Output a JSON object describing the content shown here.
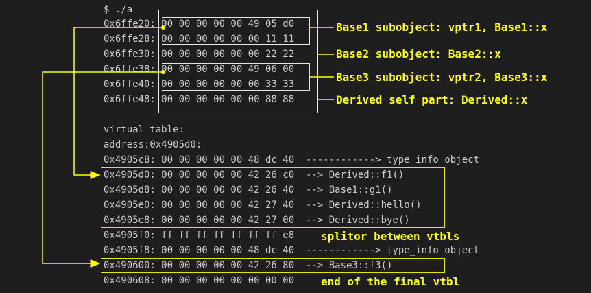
{
  "terminal": {
    "prompt": "$ ./a",
    "memory_rows": [
      "0x6ffe20: 00 00 00 00 00 49 05 d0",
      "0x6ffe28: 00 00 00 00 00 00 11 11",
      "0x6ffe30: 00 00 00 00 00 00 22 22",
      "0x6ffe38: 00 00 00 00 00 49 06 00",
      "0x6ffe40: 00 00 00 00 00 00 33 33",
      "0x6ffe48: 00 00 00 00 00 00 88 88"
    ],
    "vtable_header": "virtual table:",
    "vtable_address": "address:0x4905d0:",
    "vtable_rows": [
      "0x4905c8: 00 00 00 00 00 48 dc 40  ------------> type_info object",
      "0x4905d0: 00 00 00 00 00 42 26 c0  --> Derived::f1()",
      "0x4905d8: 00 00 00 00 00 42 26 40  --> Base1::g1()",
      "0x4905e0: 00 00 00 00 00 42 27 40  --> Derived::hello()",
      "0x4905e8: 00 00 00 00 00 42 27 00  --> Derived::bye()",
      "0x4905f0: ff ff ff ff ff ff ff e8",
      "0x4905f8: 00 00 00 00 00 48 dc 40  ------------> type_info object",
      "0x490600: 00 00 00 00 00 42 26 80  --> Base3::f3()",
      "0x490608: 00 00 00 00 00 00 00 00"
    ]
  },
  "annotations": {
    "base1": "Base1 subobject: vptr1, Base1::x",
    "base2": "Base2 subobject: Base2::x",
    "base3": "Base3 subobject: vptr2, Base3::x",
    "derived": "Derived self part: Derived::x",
    "splitor": "splitor between vtbls",
    "end": "end of the final vtbl"
  },
  "colors": {
    "background": "#1e1e1e",
    "terminal_text": "#cccccc",
    "annotation": "#ffff00",
    "box_white": "#e6e6e6"
  }
}
